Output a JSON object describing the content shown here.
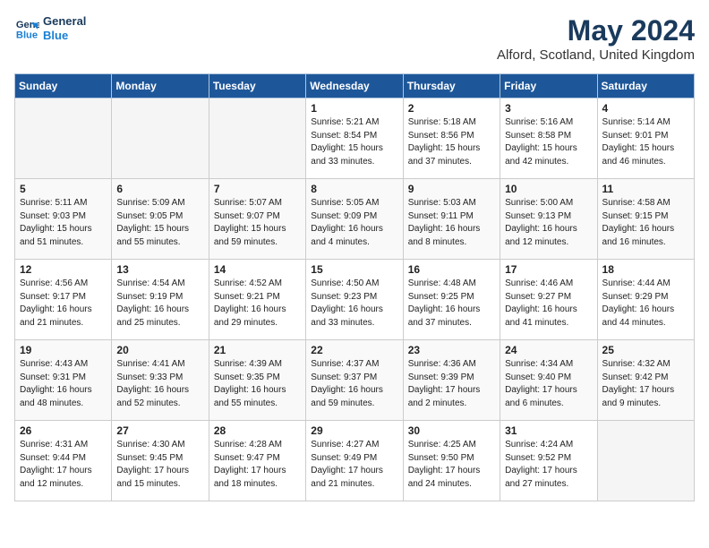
{
  "header": {
    "logo_line1": "General",
    "logo_line2": "Blue",
    "month_title": "May 2024",
    "location": "Alford, Scotland, United Kingdom"
  },
  "days_of_week": [
    "Sunday",
    "Monday",
    "Tuesday",
    "Wednesday",
    "Thursday",
    "Friday",
    "Saturday"
  ],
  "weeks": [
    [
      {
        "day": "",
        "info": ""
      },
      {
        "day": "",
        "info": ""
      },
      {
        "day": "",
        "info": ""
      },
      {
        "day": "1",
        "info": "Sunrise: 5:21 AM\nSunset: 8:54 PM\nDaylight: 15 hours\nand 33 minutes."
      },
      {
        "day": "2",
        "info": "Sunrise: 5:18 AM\nSunset: 8:56 PM\nDaylight: 15 hours\nand 37 minutes."
      },
      {
        "day": "3",
        "info": "Sunrise: 5:16 AM\nSunset: 8:58 PM\nDaylight: 15 hours\nand 42 minutes."
      },
      {
        "day": "4",
        "info": "Sunrise: 5:14 AM\nSunset: 9:01 PM\nDaylight: 15 hours\nand 46 minutes."
      }
    ],
    [
      {
        "day": "5",
        "info": "Sunrise: 5:11 AM\nSunset: 9:03 PM\nDaylight: 15 hours\nand 51 minutes."
      },
      {
        "day": "6",
        "info": "Sunrise: 5:09 AM\nSunset: 9:05 PM\nDaylight: 15 hours\nand 55 minutes."
      },
      {
        "day": "7",
        "info": "Sunrise: 5:07 AM\nSunset: 9:07 PM\nDaylight: 15 hours\nand 59 minutes."
      },
      {
        "day": "8",
        "info": "Sunrise: 5:05 AM\nSunset: 9:09 PM\nDaylight: 16 hours\nand 4 minutes."
      },
      {
        "day": "9",
        "info": "Sunrise: 5:03 AM\nSunset: 9:11 PM\nDaylight: 16 hours\nand 8 minutes."
      },
      {
        "day": "10",
        "info": "Sunrise: 5:00 AM\nSunset: 9:13 PM\nDaylight: 16 hours\nand 12 minutes."
      },
      {
        "day": "11",
        "info": "Sunrise: 4:58 AM\nSunset: 9:15 PM\nDaylight: 16 hours\nand 16 minutes."
      }
    ],
    [
      {
        "day": "12",
        "info": "Sunrise: 4:56 AM\nSunset: 9:17 PM\nDaylight: 16 hours\nand 21 minutes."
      },
      {
        "day": "13",
        "info": "Sunrise: 4:54 AM\nSunset: 9:19 PM\nDaylight: 16 hours\nand 25 minutes."
      },
      {
        "day": "14",
        "info": "Sunrise: 4:52 AM\nSunset: 9:21 PM\nDaylight: 16 hours\nand 29 minutes."
      },
      {
        "day": "15",
        "info": "Sunrise: 4:50 AM\nSunset: 9:23 PM\nDaylight: 16 hours\nand 33 minutes."
      },
      {
        "day": "16",
        "info": "Sunrise: 4:48 AM\nSunset: 9:25 PM\nDaylight: 16 hours\nand 37 minutes."
      },
      {
        "day": "17",
        "info": "Sunrise: 4:46 AM\nSunset: 9:27 PM\nDaylight: 16 hours\nand 41 minutes."
      },
      {
        "day": "18",
        "info": "Sunrise: 4:44 AM\nSunset: 9:29 PM\nDaylight: 16 hours\nand 44 minutes."
      }
    ],
    [
      {
        "day": "19",
        "info": "Sunrise: 4:43 AM\nSunset: 9:31 PM\nDaylight: 16 hours\nand 48 minutes."
      },
      {
        "day": "20",
        "info": "Sunrise: 4:41 AM\nSunset: 9:33 PM\nDaylight: 16 hours\nand 52 minutes."
      },
      {
        "day": "21",
        "info": "Sunrise: 4:39 AM\nSunset: 9:35 PM\nDaylight: 16 hours\nand 55 minutes."
      },
      {
        "day": "22",
        "info": "Sunrise: 4:37 AM\nSunset: 9:37 PM\nDaylight: 16 hours\nand 59 minutes."
      },
      {
        "day": "23",
        "info": "Sunrise: 4:36 AM\nSunset: 9:39 PM\nDaylight: 17 hours\nand 2 minutes."
      },
      {
        "day": "24",
        "info": "Sunrise: 4:34 AM\nSunset: 9:40 PM\nDaylight: 17 hours\nand 6 minutes."
      },
      {
        "day": "25",
        "info": "Sunrise: 4:32 AM\nSunset: 9:42 PM\nDaylight: 17 hours\nand 9 minutes."
      }
    ],
    [
      {
        "day": "26",
        "info": "Sunrise: 4:31 AM\nSunset: 9:44 PM\nDaylight: 17 hours\nand 12 minutes."
      },
      {
        "day": "27",
        "info": "Sunrise: 4:30 AM\nSunset: 9:45 PM\nDaylight: 17 hours\nand 15 minutes."
      },
      {
        "day": "28",
        "info": "Sunrise: 4:28 AM\nSunset: 9:47 PM\nDaylight: 17 hours\nand 18 minutes."
      },
      {
        "day": "29",
        "info": "Sunrise: 4:27 AM\nSunset: 9:49 PM\nDaylight: 17 hours\nand 21 minutes."
      },
      {
        "day": "30",
        "info": "Sunrise: 4:25 AM\nSunset: 9:50 PM\nDaylight: 17 hours\nand 24 minutes."
      },
      {
        "day": "31",
        "info": "Sunrise: 4:24 AM\nSunset: 9:52 PM\nDaylight: 17 hours\nand 27 minutes."
      },
      {
        "day": "",
        "info": ""
      }
    ]
  ]
}
